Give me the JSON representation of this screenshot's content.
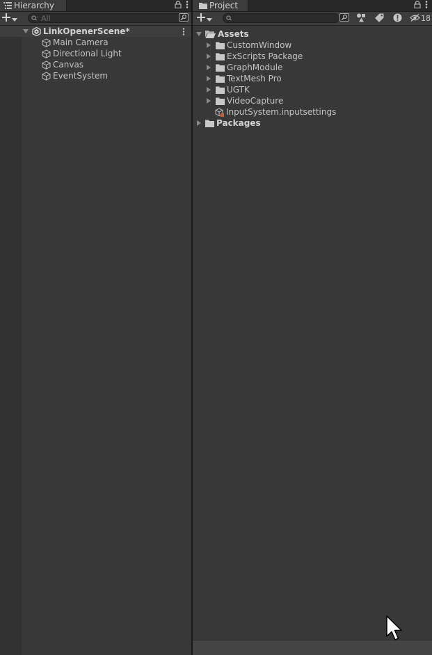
{
  "hierarchy": {
    "tab_label": "Hierarchy",
    "tab_icon": "hierarchy-list-icon",
    "search_placeholder": "All",
    "scene": {
      "name": "LinkOpenerScene*",
      "icon": "unity-scene-icon"
    },
    "objects": [
      {
        "label": "Main Camera",
        "icon": "gameobject-cube-icon"
      },
      {
        "label": "Directional Light",
        "icon": "gameobject-cube-icon"
      },
      {
        "label": "Canvas",
        "icon": "gameobject-cube-icon"
      },
      {
        "label": "EventSystem",
        "icon": "gameobject-cube-icon"
      }
    ]
  },
  "project": {
    "tab_label": "Project",
    "tab_icon": "folder-icon",
    "search_placeholder": "",
    "hidden_packages_count": "18",
    "roots": [
      {
        "label": "Assets",
        "expanded": true,
        "children": [
          {
            "label": "CustomWindow",
            "type": "folder"
          },
          {
            "label": "ExScripts Package",
            "type": "folder"
          },
          {
            "label": "GraphModule",
            "type": "folder"
          },
          {
            "label": "TextMesh Pro",
            "type": "folder"
          },
          {
            "label": "UGTK",
            "type": "folder"
          },
          {
            "label": "VideoCapture",
            "type": "folder"
          },
          {
            "label": "InputSystem.inputsettings",
            "type": "asset"
          }
        ]
      },
      {
        "label": "Packages",
        "expanded": false,
        "children": []
      }
    ]
  },
  "colors": {
    "panel_bg": "#383838",
    "tab_bar_bg": "#282828",
    "toolbar_bg": "#3c3c3c",
    "text": "#c4c4c4",
    "splitter": "#191919"
  }
}
